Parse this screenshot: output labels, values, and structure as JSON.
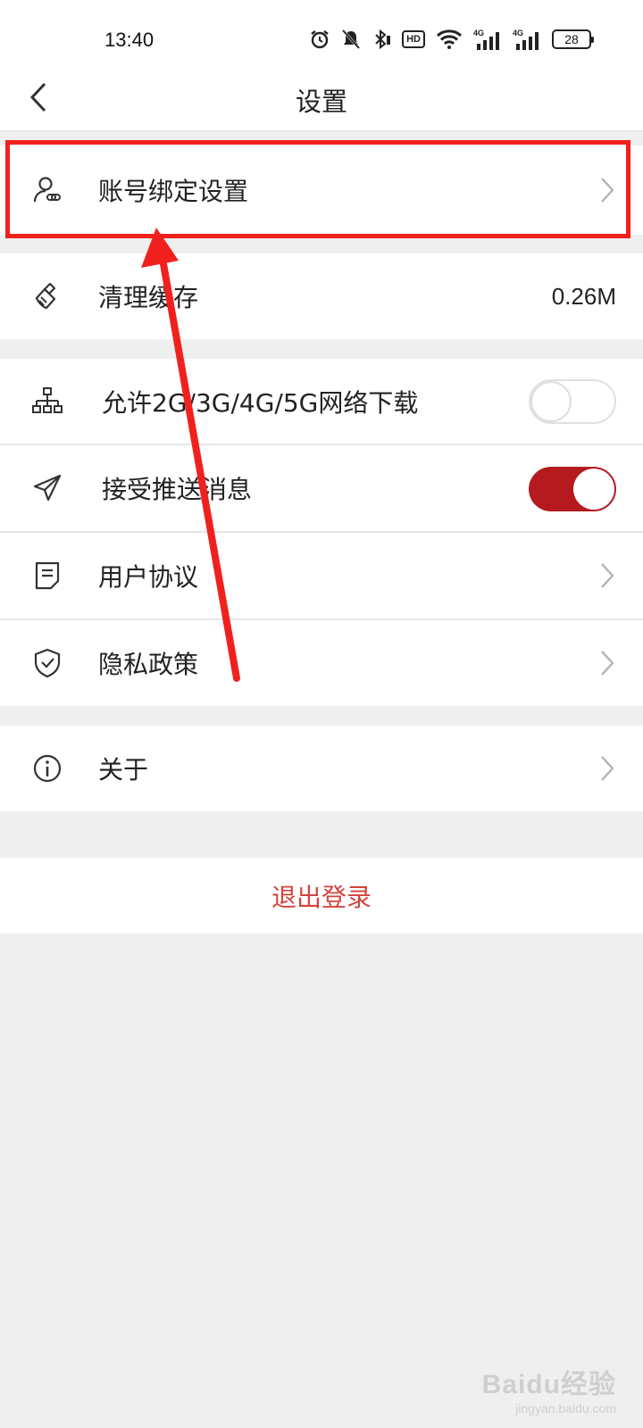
{
  "status_bar": {
    "time": "13:40",
    "hd_label": "HD",
    "battery": "28",
    "icons": [
      "alarm-icon",
      "mute-icon",
      "bluetooth-icon",
      "hd-voice-icon",
      "wifi-icon",
      "signal-4g-icon",
      "signal-4g-icon"
    ]
  },
  "header": {
    "title": "设置",
    "back_icon": "chevron-left-icon"
  },
  "settings": {
    "account_binding": {
      "label": "账号绑定设置",
      "icon": "user-link-icon"
    },
    "clear_cache": {
      "label": "清理缓存",
      "value": "0.26M",
      "icon": "brush-icon"
    },
    "mobile_download": {
      "label": "允许2G/3G/4G/5G网络下载",
      "enabled": false,
      "icon": "network-icon"
    },
    "push_messages": {
      "label": "接受推送消息",
      "enabled": true,
      "icon": "paper-plane-icon"
    },
    "user_agreement": {
      "label": "用户协议",
      "icon": "document-icon"
    },
    "privacy_policy": {
      "label": "隐私政策",
      "icon": "shield-check-icon"
    },
    "about": {
      "label": "关于",
      "icon": "info-icon"
    }
  },
  "logout": {
    "label": "退出登录"
  },
  "watermark": {
    "main": "Baidu经验",
    "sub": "jingyan.baidu.com"
  },
  "colors": {
    "accent_red": "#b51a1e",
    "logout_red": "#d4433d",
    "annotation_red": "#f0211d",
    "background": "#efefef"
  }
}
